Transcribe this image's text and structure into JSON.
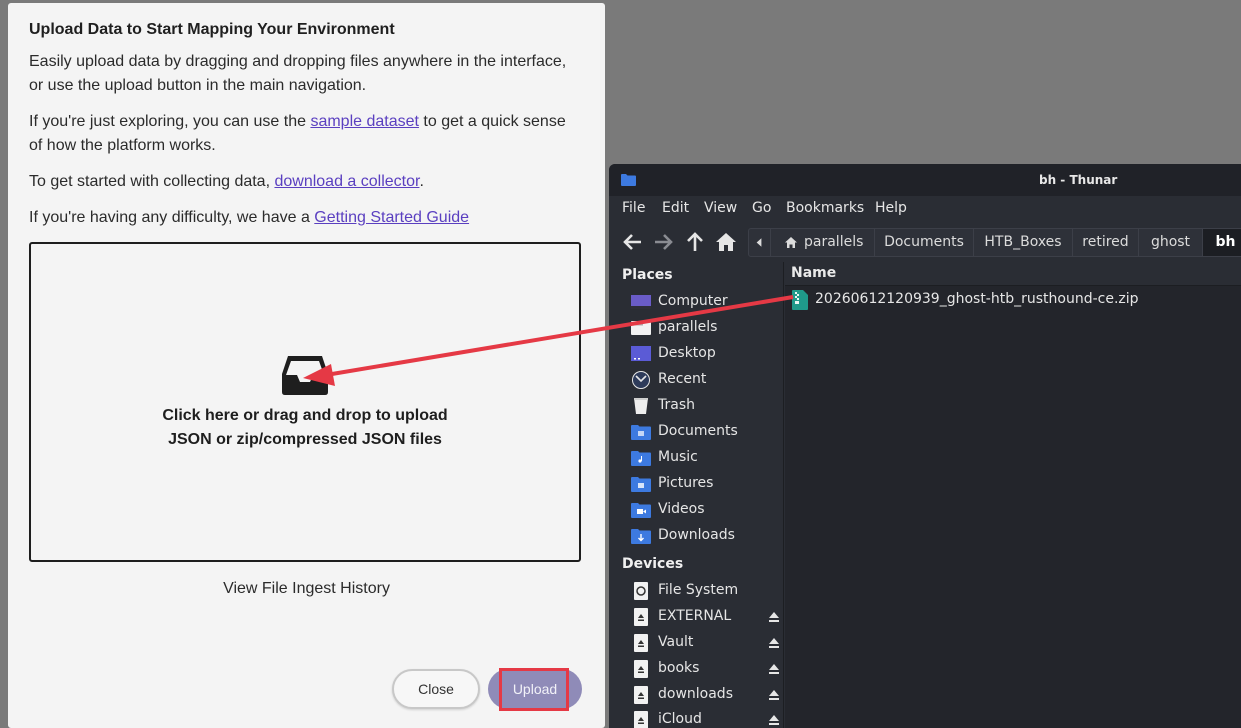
{
  "dialog": {
    "title": "Upload Data to Start Mapping Your Environment",
    "para1": "Easily upload data by dragging and dropping files anywhere in the interface, or use the upload button in the main navigation.",
    "para2_before": "If you're just exploring, you can use the ",
    "para2_link": "sample dataset",
    "para2_after": " to get a quick sense of how the platform works.",
    "para3_before": "To get started with collecting data, ",
    "para3_link": "download a collector",
    "para3_after": ".",
    "para4_before": "If you're having any difficulty, we have a ",
    "para4_link": "Getting Started Guide",
    "dropzone_line1": "Click here or drag and drop to upload",
    "dropzone_line2": "JSON or zip/compressed JSON files",
    "history_link": "View File Ingest History",
    "close_label": "Close",
    "upload_label": "Upload"
  },
  "thunar": {
    "window_title": "bh - Thunar",
    "menu": [
      "File",
      "Edit",
      "View",
      "Go",
      "Bookmarks",
      "Help"
    ],
    "breadcrumbs": [
      "parallels",
      "Documents",
      "HTB_Boxes",
      "retired",
      "ghost",
      "bh"
    ],
    "places_heading": "Places",
    "places": [
      "Computer",
      "parallels",
      "Desktop",
      "Recent",
      "Trash",
      "Documents",
      "Music",
      "Pictures",
      "Videos",
      "Downloads"
    ],
    "devices_heading": "Devices",
    "devices": [
      "File System",
      "EXTERNAL",
      "Vault",
      "books",
      "downloads",
      "iCloud"
    ],
    "column_name": "Name",
    "file_name": "20260612120939_ghost-htb_rusthound-ce.zip"
  },
  "colors": {
    "accent_link": "#5a3fc0",
    "upload_button": "#8f8bb8",
    "highlight_red": "#e53945",
    "thunar_bg": "#2a2d34",
    "folder_blue": "#3d7ae0"
  }
}
